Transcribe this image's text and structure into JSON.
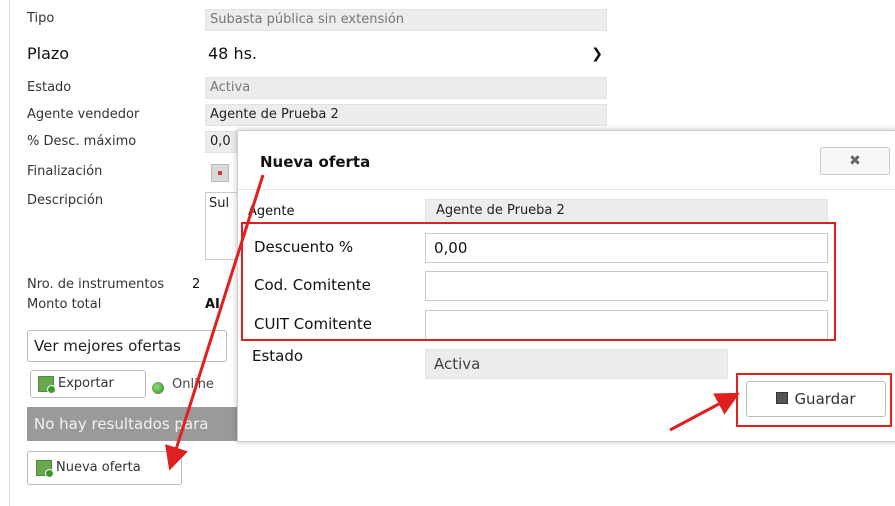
{
  "form": {
    "tipo_label": "Tipo",
    "tipo_value": "Subasta pública sin extensión",
    "plazo_label": "Plazo",
    "plazo_value": "48 hs.",
    "estado_label": "Estado",
    "estado_value": "Activa",
    "agente_label": "Agente vendedor",
    "agente_value": "Agente de Prueba 2",
    "desc_label": "% Desc. máximo",
    "desc_value": "0,0",
    "finalizacion_label": "Finalización",
    "descripcion_label": "Descripción",
    "descripcion_value": "Sul",
    "nro_label": "Nro. de instrumentos",
    "nro_value": "2",
    "monto_label": "Monto total",
    "monto_value": "AI"
  },
  "toolbar": {
    "ver_label": "Ver mejores ofertas",
    "exportar_label": "Exportar",
    "online_label": "Online",
    "no_results": "No hay resultados para",
    "nueva_label": "Nueva oferta"
  },
  "modal": {
    "title": "Nueva oferta",
    "close_label": "✖",
    "agente_label": "Agente",
    "agente_value": "Agente de Prueba 2",
    "descuento_label": "Descuento %",
    "descuento_value": "0,00",
    "cod_label": "Cod. Comitente",
    "cod_value": "",
    "cuit_label": "CUIT Comitente",
    "cuit_value": "",
    "estado_label": "Estado",
    "estado_value": "Activa",
    "guardar_label": "Guardar"
  },
  "colors": {
    "highlight": "#e02020",
    "no_results_bar": "#9a9a9a",
    "readonly_bg": "#ececec"
  },
  "icons": [
    "chevron-down-icon",
    "excel-icon",
    "online-status-icon",
    "add-offer-icon",
    "close-icon",
    "save-icon"
  ]
}
